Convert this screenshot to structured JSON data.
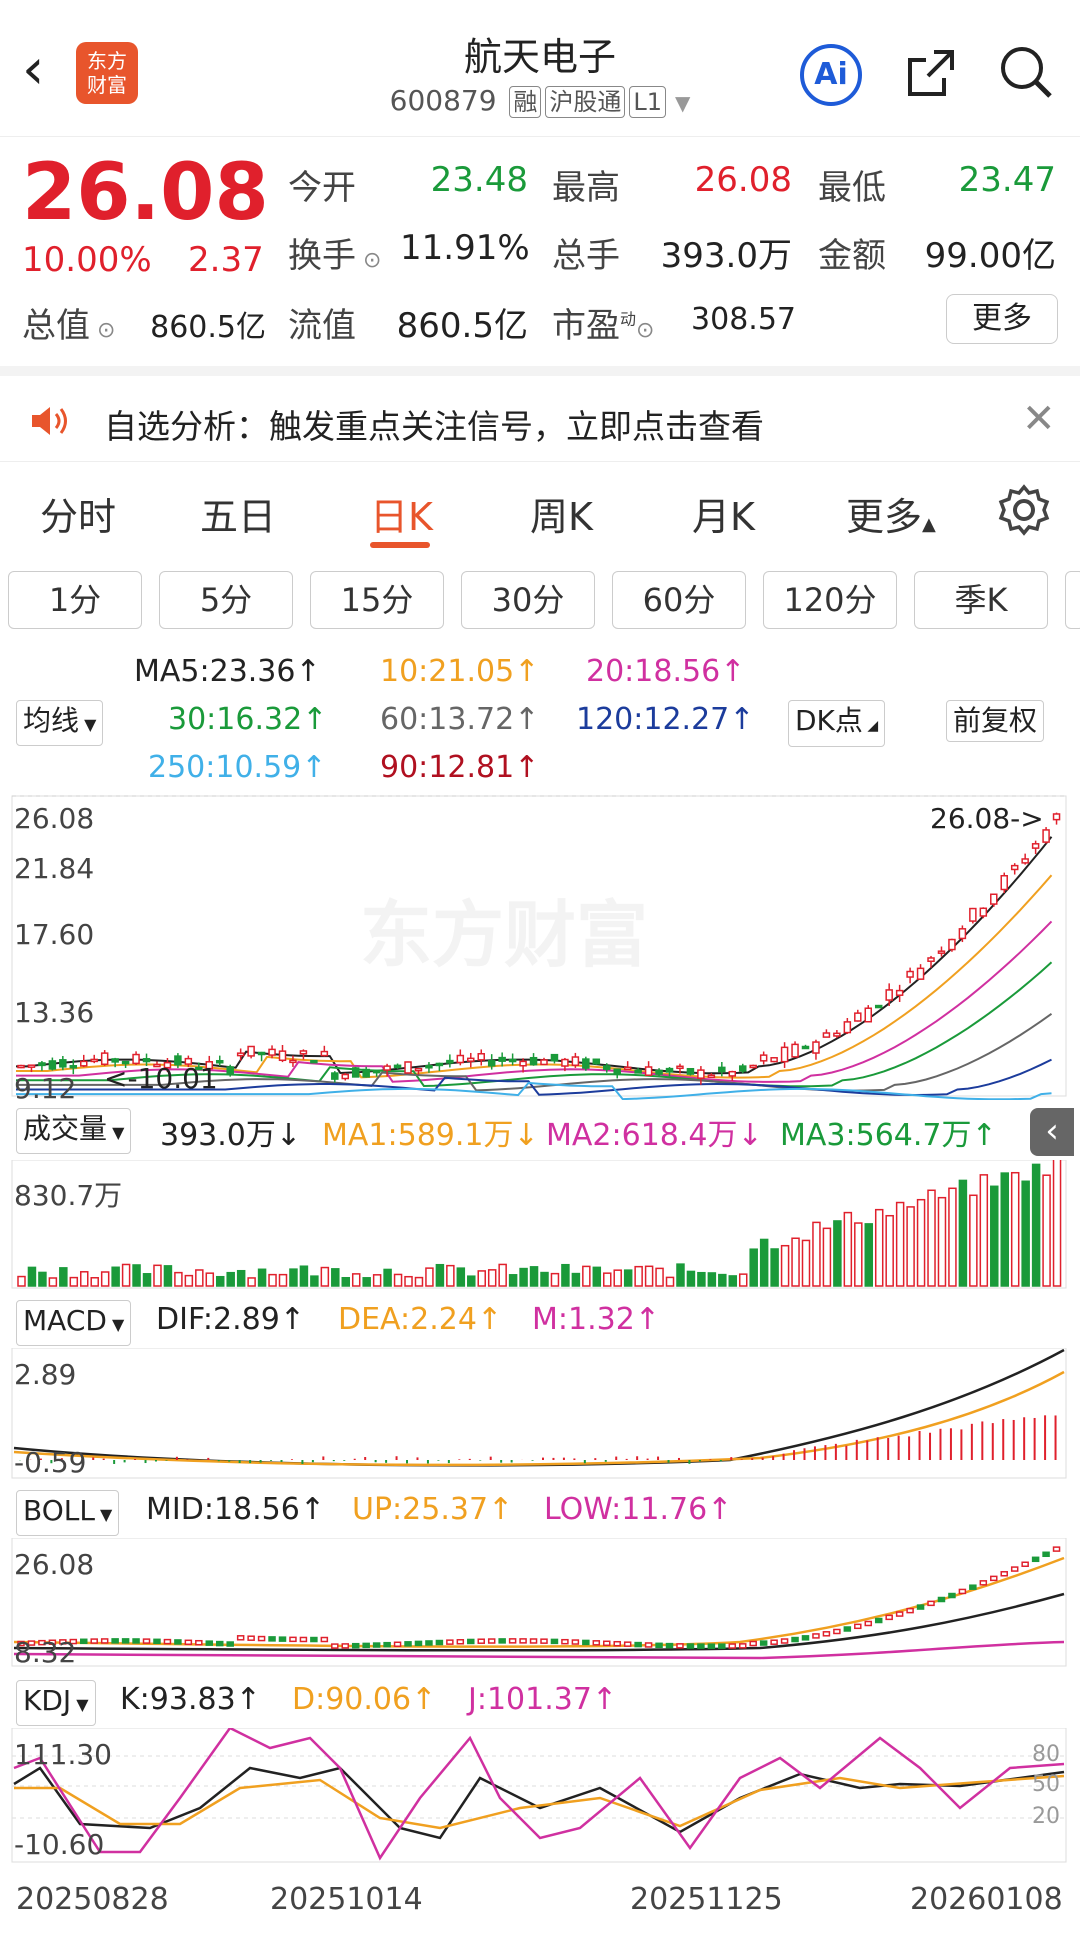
{
  "header": {
    "title": "航天电子",
    "code": "600879",
    "tags": [
      "融",
      "沪股通",
      "L1"
    ],
    "logo_text_1": "东方",
    "logo_text_2": "财富",
    "ai_label": "Ai"
  },
  "quote": {
    "price": "26.08",
    "change_pct": "10.00%",
    "change": "2.37",
    "open_label": "今开",
    "open": "23.48",
    "high_label": "最高",
    "high": "26.08",
    "low_label": "最低",
    "low": "23.47",
    "turnover_label": "换手",
    "turnover": "11.91%",
    "volume_label": "总手",
    "volume": "393.0万",
    "amount_label": "金额",
    "amount": "99.00亿",
    "mktcap_label": "总值",
    "mktcap": "860.5亿",
    "float_label": "流值",
    "float": "860.5亿",
    "pe_label": "市盈",
    "pe_sup": "动",
    "pe": "308.57",
    "more_label": "更多"
  },
  "notice": {
    "text": "自选分析：触发重点关注信号，立即点击查看"
  },
  "period_tabs": [
    "分时",
    "五日",
    "日K",
    "周K",
    "月K",
    "更多"
  ],
  "active_period": "日K",
  "interval_buttons": [
    "1分",
    "5分",
    "15分",
    "30分",
    "60分",
    "120分",
    "季K"
  ],
  "ma_panel": {
    "selector": "均线",
    "ma5": "MA5:23.36↑",
    "ma10": "10:21.05↑",
    "ma20": "20:18.56↑",
    "ma30": "30:16.32↑",
    "ma60": "60:13.72↑",
    "ma120": "120:12.27↑",
    "ma250": "250:10.59↑",
    "ma90": "90:12.81↑",
    "dk_label": "DK点",
    "adjust_label": "前复权"
  },
  "kline_axis": {
    "y_labels": [
      "26.08",
      "21.84",
      "17.60",
      "13.36",
      "9.12"
    ],
    "last_marker": "26.08->",
    "low_marker": "10.01"
  },
  "volume_panel": {
    "selector": "成交量",
    "vol": "393.0万↓",
    "ma1": "MA1:589.1万↓",
    "ma2": "MA2:618.4万↓",
    "ma3": "MA3:564.7万↑",
    "y_label": "830.7万"
  },
  "macd_panel": {
    "selector": "MACD",
    "dif": "DIF:2.89↑",
    "dea": "DEA:2.24↑",
    "m": "M:1.32↑",
    "y_top": "2.89",
    "y_bottom": "-0.59"
  },
  "boll_panel": {
    "selector": "BOLL",
    "mid": "MID:18.56↑",
    "up": "UP:25.37↑",
    "low": "LOW:11.76↑",
    "y_top": "26.08",
    "y_bottom": "8.32"
  },
  "kdj_panel": {
    "selector": "KDJ",
    "k": "K:93.83↑",
    "d": "D:90.06↑",
    "j": "J:101.37↑",
    "y_top": "111.30",
    "y_bottom": "-10.60",
    "levels": [
      "80",
      "50",
      "20"
    ]
  },
  "date_axis": [
    "20250828",
    "20251014",
    "20251125",
    "20260108"
  ],
  "colors": {
    "up": "#e0202c",
    "down": "#1a9a3a",
    "accent": "#e8552c",
    "ma10": "#f0a020",
    "ma20": "#d030a0",
    "ma120": "#1c3c9c",
    "ma250": "#40b0e8",
    "ma90": "#b01020"
  }
}
